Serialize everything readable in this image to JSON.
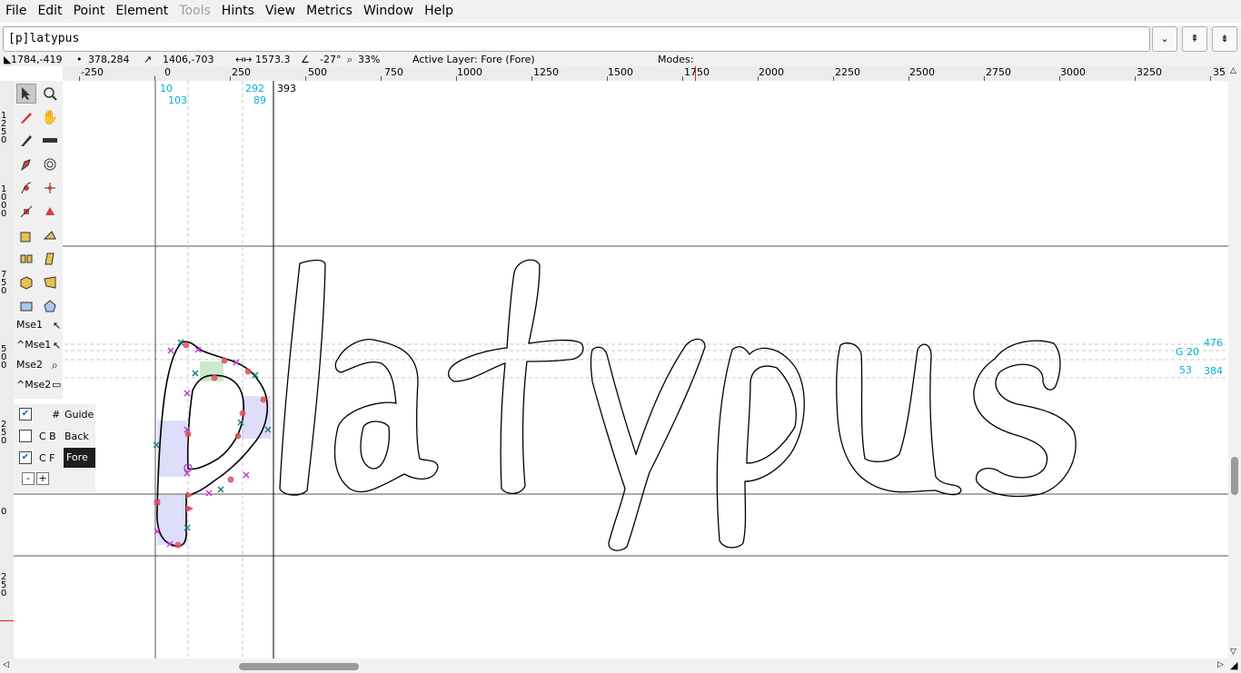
{
  "menu": [
    "File",
    "Edit",
    "Point",
    "Element",
    "Tools",
    "Hints",
    "View",
    "Metrics",
    "Window",
    "Help"
  ],
  "menu_disabled": "Tools",
  "glyph_field": "[p]latypus",
  "status": {
    "cursor": "1784,-419",
    "point": "378,284",
    "delta": "1406,-703",
    "distance": "1573.3",
    "angle": "-27°",
    "zoom": "33%",
    "active_layer": "Active Layer: Fore (Fore)",
    "modes": "Modes:"
  },
  "hruler_labels": [
    "-250",
    "0",
    "250",
    "500",
    "750",
    "1000",
    "1250",
    "1500",
    "1750",
    "2000",
    "2250",
    "2500",
    "2750",
    "3000",
    "3250",
    "35"
  ],
  "vruler_labels": [
    "1250",
    "1000",
    "750",
    "500",
    "250",
    "0",
    "250"
  ],
  "canvas_labels": {
    "lsb_top": "10",
    "lsb_bottom": "103",
    "rsb_top": "292",
    "rsb_bottom": "89",
    "width": "393",
    "hint_right_top": "476",
    "hint_label": "G 20",
    "hint_right_bottom_a": "53",
    "hint_right_bottom_b": "384"
  },
  "mouse_labels": [
    "Mse1",
    "^Mse1",
    "Mse2",
    "^Mse2"
  ],
  "layers": [
    {
      "checked": true,
      "prefix": "#",
      "name": "Guide"
    },
    {
      "checked": false,
      "prefix": "C  B",
      "name": "Back"
    },
    {
      "checked": true,
      "prefix": "C  F",
      "name": "Fore"
    }
  ],
  "layer_buttons": [
    "-",
    "+"
  ],
  "colors": {
    "cyan": "#00b3c8",
    "point_magenta": "#c23ad6",
    "point_teal": "#1a8080",
    "point_red": "#e0505a"
  }
}
